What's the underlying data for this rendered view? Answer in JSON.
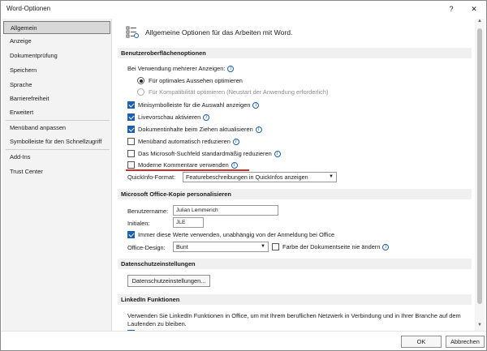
{
  "window": {
    "title": "Word-Optionen",
    "help": "?",
    "close": "✕"
  },
  "sidebar": {
    "items": [
      {
        "label": "Allgemein",
        "active": true
      },
      {
        "label": "Anzeige"
      },
      {
        "label": "Dokumentprüfung"
      },
      {
        "label": "Speichern"
      },
      {
        "label": "Sprache"
      },
      {
        "label": "Barrierefreiheit"
      },
      {
        "label": "Erweitert"
      },
      {
        "label": "Menüband anpassen"
      },
      {
        "label": "Symbolleiste für den Schnellzugriff"
      },
      {
        "label": "Add-Ins"
      },
      {
        "label": "Trust Center"
      }
    ]
  },
  "content": {
    "header": "Allgemeine Optionen für das Arbeiten mit Word.",
    "ui": {
      "heading": "Benutzeroberflächenoptionen",
      "multi_display": "Bei Verwendung mehrerer Anzeigen:",
      "radio_opt": "Für optimales Aussehen optimieren",
      "radio_compat": "Für Kompatibilität optimieren (Neustart der Anwendung erforderlich)",
      "cb_minitoolbar": "Minisymbolleiste für die Auswahl anzeigen",
      "cb_livepreview": "Livevorschau aktivieren",
      "cb_dragupdate": "Dokumentinhalte beim Ziehen aktualisieren",
      "cb_collapse_ribbon": "Menüband automatisch reduzieren",
      "cb_search_collapse": "Das Microsoft-Suchfeld standardmäßig reduzieren",
      "cb_modern_comments": "Moderne Kommentare verwenden",
      "quickinfo_label": "QuickInfo-Format:",
      "quickinfo_value": "Featurebeschreibungen in QuickInfos anzeigen"
    },
    "personalize": {
      "heading": "Microsoft Office-Kopie personalisieren",
      "username_label": "Benutzername:",
      "username_value": "Julian Lemmerich",
      "initials_label": "Initialen:",
      "initials_value": "JLE",
      "always_use": "Immer diese Werte verwenden, unabhängig von der Anmeldung bei Office",
      "design_label": "Office-Design:",
      "design_value": "Bunt",
      "page_color": "Farbe der Dokumentseite nie ändern"
    },
    "privacy": {
      "heading": "Datenschutzeinstellungen",
      "button": "Datenschutzeinstellungen..."
    },
    "linkedin": {
      "heading": "LinkedIn Funktionen",
      "text": "Verwenden Sie LinkedIn Funktionen in Office, um mit Ihrem beruflichen Netzwerk in Verbindung und in Ihrer Branche auf dem Laufenden zu bleiben."
    }
  },
  "footer": {
    "ok": "OK",
    "cancel": "Abbrechen"
  },
  "colors": {
    "accent": "#1a5fb4",
    "highlight_line": "#d12b2b"
  }
}
